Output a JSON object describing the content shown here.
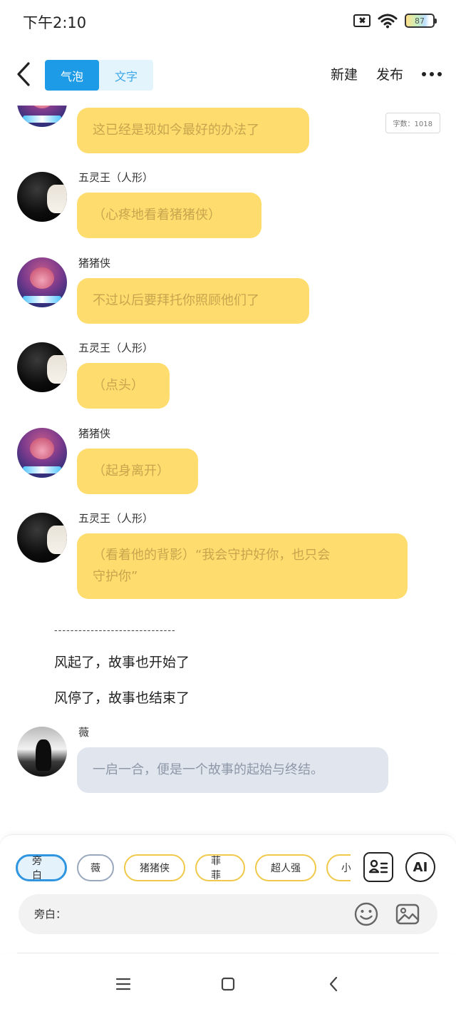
{
  "status_bar": {
    "time": "下午2:10",
    "battery": "87"
  },
  "nav": {
    "tabs": [
      {
        "label": "气泡",
        "active": true
      },
      {
        "label": "文字",
        "active": false
      }
    ],
    "new_label": "新建",
    "publish_label": "发布"
  },
  "word_count": "字数：1018",
  "messages": [
    {
      "speaker": "",
      "text": "这已经是现如今最好的办法了",
      "avatar": "pig-icon"
    },
    {
      "speaker": "五灵王（人形）",
      "text": "（心疼地看着猪猪侠）",
      "avatar": "dark-portrait-icon"
    },
    {
      "speaker": "猪猪侠",
      "text": "不过以后要拜托你照顾他们了",
      "avatar": "pig-icon"
    },
    {
      "speaker": "五灵王（人形）",
      "text": "（点头）",
      "avatar": "dark-portrait-icon"
    },
    {
      "speaker": "猪猪侠",
      "text": "（起身离开）",
      "avatar": "pig-icon"
    },
    {
      "speaker": "五灵王（人形）",
      "text_line1": "（看着他的背影）“我会守护好你，也只会",
      "text_line2": "守护你”",
      "avatar": "dark-portrait-icon"
    }
  ],
  "divider": "------------------------------",
  "narration": [
    "风起了，故事也开始了",
    "风停了，故事也结束了"
  ],
  "final_message": {
    "speaker": "薇",
    "text": "一启一合，便是一个故事的起始与终结。",
    "avatar": "girl-portrait-icon"
  },
  "role_chips": [
    "旁白",
    "薇",
    "猪猪侠",
    "菲菲",
    "超人强",
    "小"
  ],
  "input": {
    "label": "旁白：",
    "value": ""
  },
  "tools": {
    "ai_label": "AI"
  },
  "colors": {
    "bubble_yellow": "#fedd6e",
    "bubble_gray": "#e1e6ee",
    "accent_blue": "#1e9be6"
  }
}
